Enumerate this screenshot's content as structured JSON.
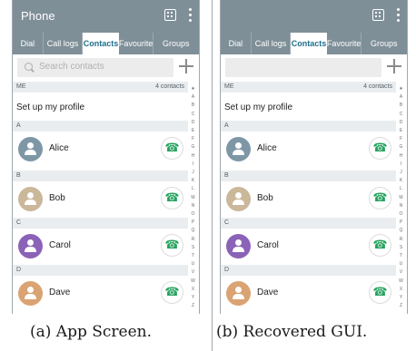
{
  "colors": {
    "accent": "#7f8f98",
    "active_tab_text": "#1f6f8b",
    "call_icon": "#27a35e"
  },
  "panels": [
    {
      "app_title": "Phone",
      "tabs": [
        "Dial",
        "Call logs",
        "Contacts",
        "Favourite",
        "Groups"
      ],
      "active_tab": "Contacts",
      "search_placeholder": "Search contacts",
      "me_header": "ME",
      "me_count": "4 contacts",
      "profile_label": "Set up my profile",
      "sections": [
        {
          "letter": "A",
          "name": "Alice",
          "avatar_color": "#7d97a6"
        },
        {
          "letter": "B",
          "name": "Bob",
          "avatar_color": "#cbb79a"
        },
        {
          "letter": "C",
          "name": "Carol",
          "avatar_color": "#8a62b7"
        },
        {
          "letter": "D",
          "name": "Dave",
          "avatar_color": "#d9a373"
        }
      ],
      "index_letters": [
        "★",
        "A",
        "B",
        "C",
        "D",
        "E",
        "F",
        "G",
        "H",
        "I",
        "J",
        "K",
        "L",
        "M",
        "N",
        "O",
        "P",
        "Q",
        "R",
        "S",
        "T",
        "U",
        "V",
        "W",
        "X",
        "Y",
        "Z"
      ]
    },
    {
      "app_title": "",
      "tabs": [
        "Dial",
        "Call logs",
        "Contacts",
        "Favourite",
        "Groups"
      ],
      "active_tab": "Contacts",
      "search_placeholder": "",
      "me_header": "ME",
      "me_count": "4 contacts",
      "profile_label": "Set up my profile",
      "sections": [
        {
          "letter": "A",
          "name": "Alice",
          "avatar_color": "#7d97a6"
        },
        {
          "letter": "B",
          "name": "Bob",
          "avatar_color": "#cbb79a"
        },
        {
          "letter": "C",
          "name": "Carol",
          "avatar_color": "#8a62b7"
        },
        {
          "letter": "D",
          "name": "Dave",
          "avatar_color": "#d9a373"
        }
      ],
      "index_letters": [
        "★",
        "A",
        "B",
        "C",
        "D",
        "E",
        "F",
        "G",
        "H",
        "I",
        "J",
        "K",
        "L",
        "M",
        "N",
        "O",
        "P",
        "Q",
        "R",
        "S",
        "T",
        "U",
        "V",
        "W",
        "X",
        "Y",
        "Z"
      ]
    }
  ],
  "captions": [
    "(a) App Screen.",
    "(b) Recovered GUI."
  ]
}
